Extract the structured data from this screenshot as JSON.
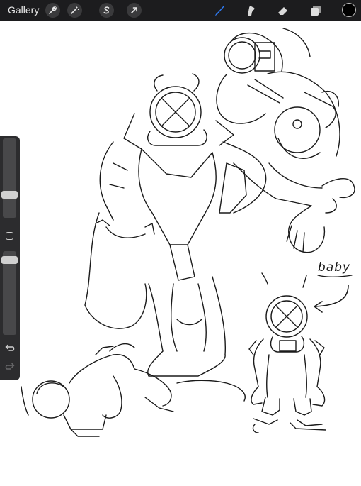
{
  "topbar": {
    "gallery_label": "Gallery",
    "tools": [
      "wrench-icon",
      "magic-wand-icon",
      "selection-s-icon",
      "transform-arrow-icon"
    ],
    "right_tools": [
      "brush-icon",
      "smudge-icon",
      "eraser-icon",
      "layers-icon"
    ],
    "active_tool": "brush-icon",
    "accent_color": "#2f7cf6",
    "current_color": "#000000"
  },
  "sidebar": {
    "brush_size_level": 0.27,
    "opacity_level": 0.07,
    "buttons": [
      "modify-square-icon",
      "undo-icon",
      "redo-icon"
    ]
  },
  "canvas": {
    "annotation_text": "baby"
  }
}
